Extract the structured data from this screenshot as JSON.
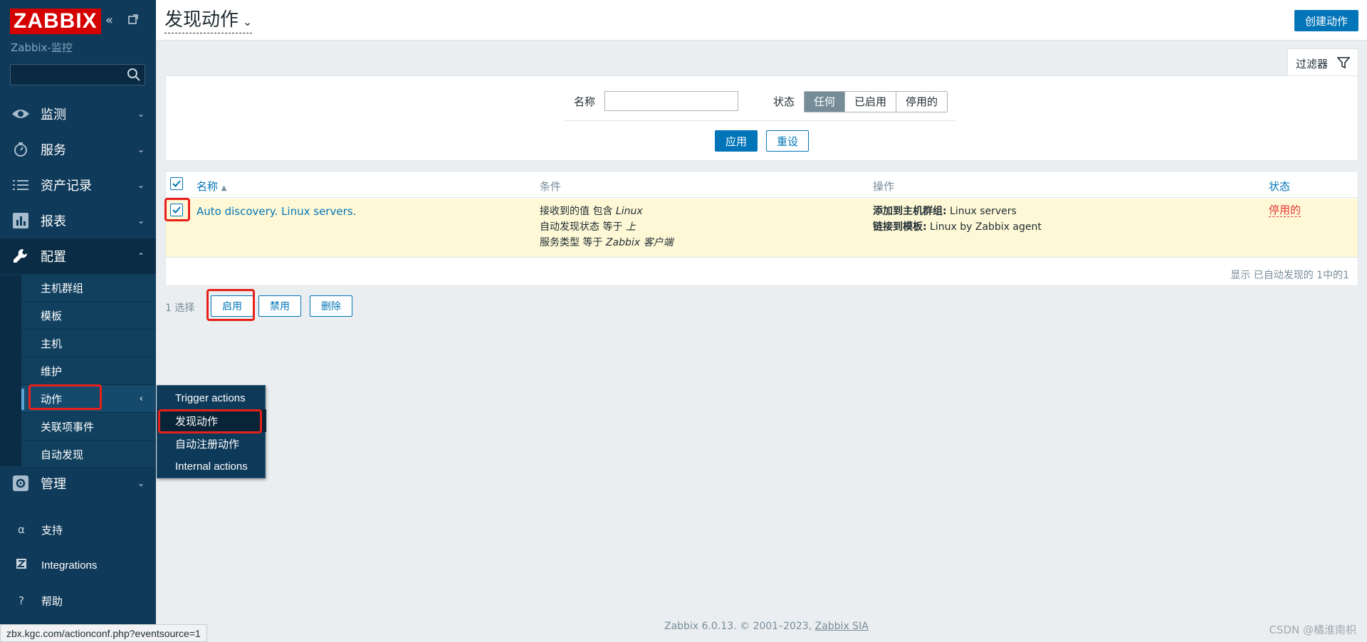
{
  "sidebar": {
    "logo": "ZABBIX",
    "subtitle": "Zabbix-监控",
    "search_placeholder": "",
    "menu": [
      {
        "label": "监测",
        "icon": "eye-icon"
      },
      {
        "label": "服务",
        "icon": "clock-icon"
      },
      {
        "label": "资产记录",
        "icon": "list-icon"
      },
      {
        "label": "报表",
        "icon": "chart-icon"
      },
      {
        "label": "配置",
        "icon": "wrench-icon"
      },
      {
        "label": "管理",
        "icon": "gear-icon"
      }
    ],
    "config_submenu": [
      "主机群组",
      "模板",
      "主机",
      "维护",
      "动作",
      "关联项事件",
      "自动发现"
    ],
    "bottom": [
      {
        "label": "支持",
        "icon": "headset-icon"
      },
      {
        "label": "Integrations",
        "icon": "zabbix-z-icon"
      },
      {
        "label": "帮助",
        "icon": "question-icon"
      }
    ]
  },
  "popup": {
    "items": [
      "Trigger actions",
      "发现动作",
      "自动注册动作",
      "Internal actions"
    ]
  },
  "header": {
    "title": "发现动作",
    "create_button": "创建动作"
  },
  "filter": {
    "tab_label": "过滤器",
    "name_label": "名称",
    "name_value": "",
    "status_label": "状态",
    "status_options": [
      "任何",
      "已启用",
      "停用的"
    ],
    "status_selected": "任何",
    "apply": "应用",
    "reset": "重设"
  },
  "table": {
    "columns": {
      "name": "名称",
      "name_sort": "▲",
      "conditions": "条件",
      "operations": "操作",
      "status": "状态"
    },
    "rows": [
      {
        "name": "Auto discovery. Linux servers.",
        "conditions": [
          {
            "text": "接收到的值 包含 ",
            "value": "Linux"
          },
          {
            "text": "自动发现状态 等于 ",
            "value": "上"
          },
          {
            "text": "服务类型 等于 ",
            "value": "Zabbix 客户端"
          }
        ],
        "operations": [
          {
            "key": "添加到主机群组:",
            "value": " Linux servers"
          },
          {
            "key": "链接到模板:",
            "value": " Linux by Zabbix agent"
          }
        ],
        "status": "停用的"
      }
    ],
    "footer": "显示 已自动发现的 1中的1"
  },
  "actions_bar": {
    "selected": "1 选择",
    "buttons": [
      "启用",
      "禁用",
      "删除"
    ]
  },
  "footer": {
    "text": "Zabbix 6.0.13. © 2001–2023, ",
    "link": "Zabbix SIA"
  },
  "status_url": "zbx.kgc.com/actionconf.php?eventsource=1",
  "watermark": "CSDN @橘淮南枳",
  "colors": {
    "sidebar_bg": "#0f3a5a",
    "accent": "#0275b8",
    "logo_red": "#d40000",
    "row_highlight": "#fef8d6",
    "disabled_status": "#e33734"
  }
}
